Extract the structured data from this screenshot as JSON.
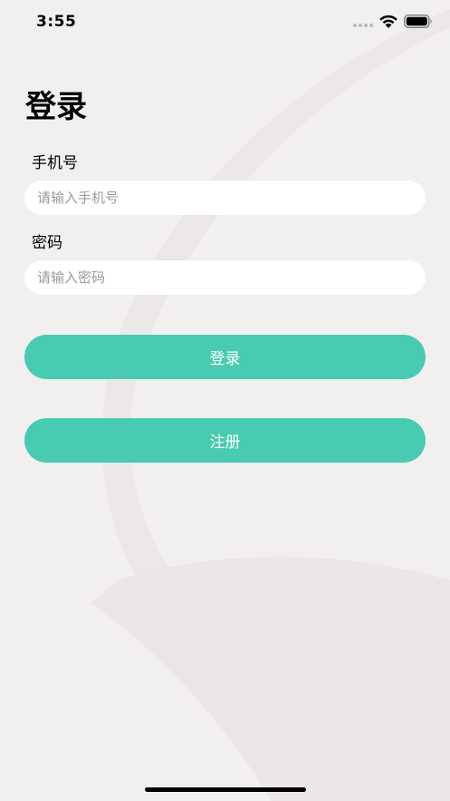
{
  "status_bar": {
    "time": "3:55",
    "icons": [
      "signal-dots-icon",
      "wifi-icon",
      "battery-icon"
    ]
  },
  "page": {
    "title": "登录"
  },
  "form": {
    "phone_label": "手机号",
    "phone_placeholder": "请输入手机号",
    "phone_value": "",
    "password_label": "密码",
    "password_placeholder": "请输入密码",
    "password_value": ""
  },
  "actions": {
    "login_label": "登录",
    "register_label": "注册"
  },
  "colors": {
    "background": "#f2efef",
    "accent": "#48cbb1",
    "input_background": "#ffffff"
  }
}
